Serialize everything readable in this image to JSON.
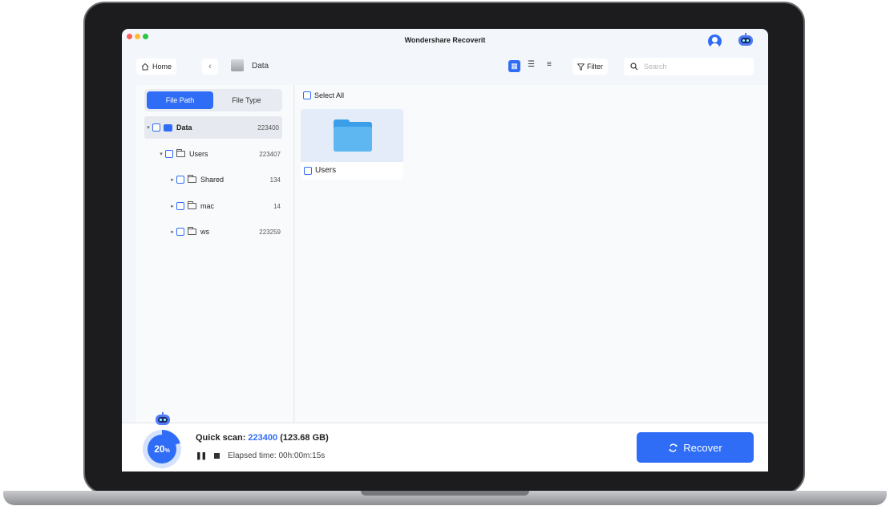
{
  "window": {
    "title": "Wondershare Recoverit"
  },
  "toolbar": {
    "home_label": "Home",
    "back_glyph": "‹",
    "breadcrumb": "Data",
    "filter_label": "Filter",
    "search_placeholder": "Search"
  },
  "sidebar": {
    "tabs": [
      {
        "label": "File Path",
        "active": true
      },
      {
        "label": "File Type",
        "active": false
      }
    ],
    "tree": [
      {
        "label": "Data",
        "count": "223400",
        "icon": "disk-icon"
      },
      {
        "label": "Users",
        "count": "223407",
        "icon": "folder-icon"
      },
      {
        "label": "Shared",
        "count": "134",
        "icon": "folder-icon"
      },
      {
        "label": "mac",
        "count": "14",
        "icon": "folder-icon"
      },
      {
        "label": "ws",
        "count": "223259",
        "icon": "folder-icon"
      }
    ]
  },
  "main": {
    "select_all_label": "Select All",
    "items": [
      {
        "label": "Users",
        "icon": "folder-icon"
      }
    ]
  },
  "status": {
    "progress_percent": "20",
    "progress_symbol": "%",
    "progress_fraction": 0.2,
    "scan_label": "Quick scan:",
    "scan_count": "223400",
    "scan_size": "(123.68 GB)",
    "elapsed": "Elapsed time: 00h:00m:15s",
    "recover_label": "Recover"
  },
  "colors": {
    "accent": "#2f6df6",
    "folder": "#5fb7f2"
  }
}
